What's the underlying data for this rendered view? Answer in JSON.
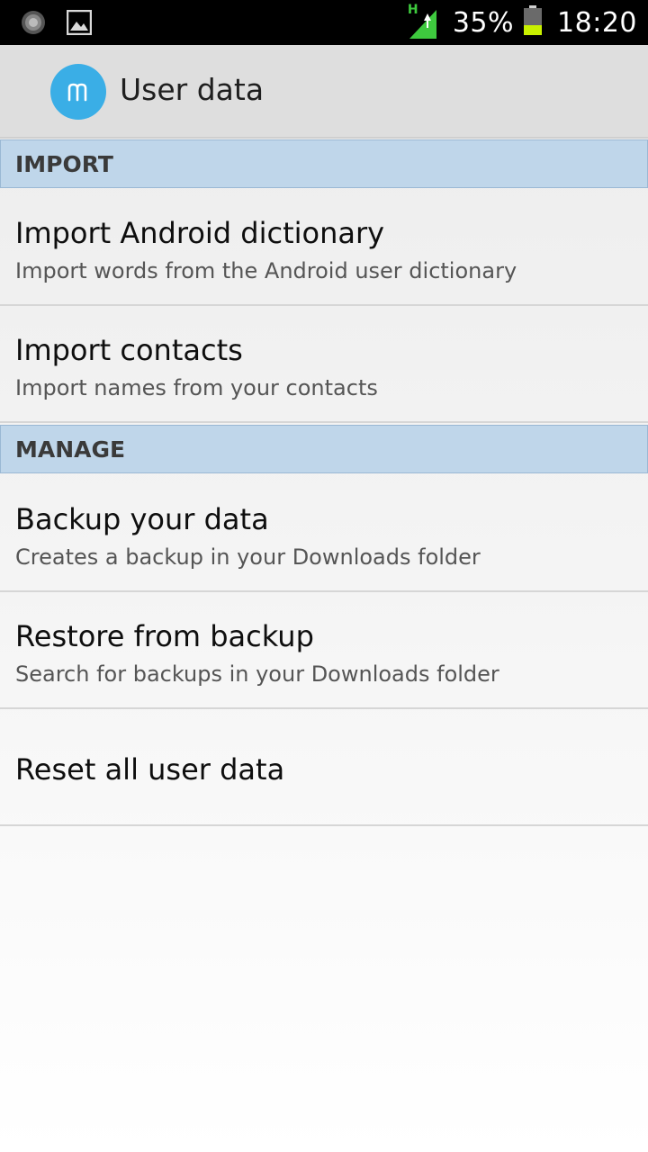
{
  "status_bar": {
    "network_type": "H",
    "battery_percent": "35%",
    "time": "18:20",
    "colors": {
      "signal": "#3ec93e",
      "battery_fill": "#c8f000"
    }
  },
  "action_bar": {
    "title": "User data",
    "logo_letter": "m",
    "logo_color": "#3aaee6"
  },
  "sections": [
    {
      "header": "IMPORT",
      "items": [
        {
          "title": "Import Android dictionary",
          "subtitle": "Import words from the Android user dictionary"
        },
        {
          "title": "Import contacts",
          "subtitle": "Import names from your contacts"
        }
      ]
    },
    {
      "header": "MANAGE",
      "items": [
        {
          "title": "Backup your data",
          "subtitle": "Creates a backup in your Downloads folder"
        },
        {
          "title": "Restore from backup",
          "subtitle": "Search for backups in your Downloads folder"
        },
        {
          "title": "Reset all user data"
        }
      ]
    }
  ],
  "icons": {
    "status_left": [
      "notification-spinner-icon",
      "image-notification-icon"
    ],
    "status_right": [
      "signal-strength-icon",
      "battery-icon"
    ]
  }
}
